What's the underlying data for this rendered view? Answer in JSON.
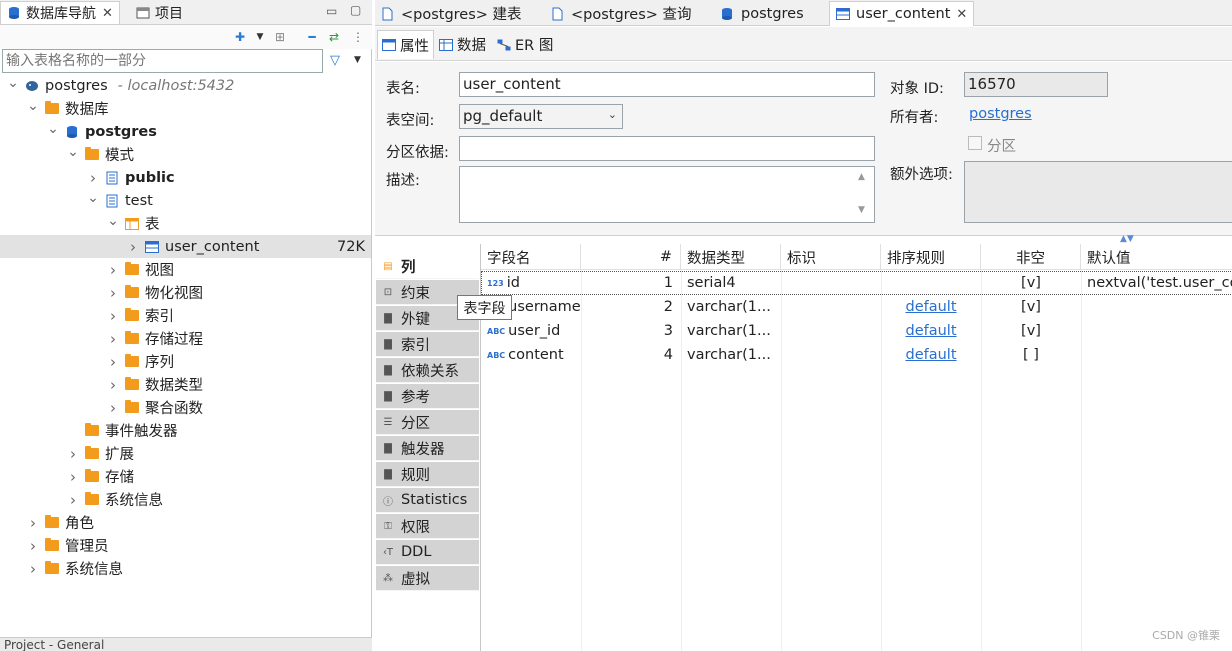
{
  "left_tabs": [
    {
      "label": "数据库导航",
      "icon": "database-navigator-icon",
      "closable": true
    },
    {
      "label": "项目",
      "icon": "project-icon",
      "closable": false
    }
  ],
  "filter": {
    "placeholder": "输入表格名称的一部分"
  },
  "tree": [
    {
      "label": "postgres",
      "suffix": "- localhost:5432",
      "indent": 0,
      "expanded": true,
      "icon": "postgres-elephant-icon",
      "bold": false
    },
    {
      "label": "数据库",
      "indent": 1,
      "expanded": true,
      "icon": "folder-icon"
    },
    {
      "label": "postgres",
      "indent": 2,
      "expanded": true,
      "icon": "database-icon",
      "bold": true
    },
    {
      "label": "模式",
      "indent": 3,
      "expanded": true,
      "icon": "folder-icon"
    },
    {
      "label": "public",
      "indent": 4,
      "expanded": false,
      "icon": "schema-icon",
      "bold": true
    },
    {
      "label": "test",
      "indent": 4,
      "expanded": true,
      "icon": "schema-icon"
    },
    {
      "label": "表",
      "indent": 5,
      "expanded": true,
      "icon": "tables-folder-icon"
    },
    {
      "label": "user_content",
      "indent": 6,
      "expanded": false,
      "icon": "table-icon",
      "selected": true,
      "size": "72K"
    },
    {
      "label": "视图",
      "indent": 5,
      "expanded": false,
      "icon": "folder-icon"
    },
    {
      "label": "物化视图",
      "indent": 5,
      "expanded": false,
      "icon": "folder-icon"
    },
    {
      "label": "索引",
      "indent": 5,
      "expanded": false,
      "icon": "folder-icon"
    },
    {
      "label": "存储过程",
      "indent": 5,
      "expanded": false,
      "icon": "folder-icon"
    },
    {
      "label": "序列",
      "indent": 5,
      "expanded": false,
      "icon": "folder-icon"
    },
    {
      "label": "数据类型",
      "indent": 5,
      "expanded": false,
      "icon": "folder-icon"
    },
    {
      "label": "聚合函数",
      "indent": 5,
      "expanded": false,
      "icon": "folder-icon"
    },
    {
      "label": "事件触发器",
      "indent": 3,
      "expanded": null,
      "icon": "folder-icon"
    },
    {
      "label": "扩展",
      "indent": 3,
      "expanded": false,
      "icon": "folder-icon"
    },
    {
      "label": "存储",
      "indent": 3,
      "expanded": false,
      "icon": "folder-icon"
    },
    {
      "label": "系统信息",
      "indent": 3,
      "expanded": false,
      "icon": "folder-icon"
    },
    {
      "label": "角色",
      "indent": 1,
      "expanded": false,
      "icon": "folder-icon"
    },
    {
      "label": "管理员",
      "indent": 1,
      "expanded": false,
      "icon": "folder-icon"
    },
    {
      "label": "系统信息",
      "indent": 1,
      "expanded": false,
      "icon": "folder-icon"
    }
  ],
  "bottom_panel": {
    "label": "Project - General"
  },
  "editor_tabs": [
    {
      "label": "<postgres> 建表",
      "icon": "sql-script-icon",
      "active": false
    },
    {
      "label": "<postgres> 查询",
      "icon": "sql-script-icon",
      "active": false
    },
    {
      "label": "postgres",
      "icon": "database-icon",
      "active": false
    },
    {
      "label": "user_content",
      "icon": "table-icon",
      "active": true
    }
  ],
  "sub_tabs": [
    {
      "label": "属性",
      "icon": "properties-icon",
      "active": true
    },
    {
      "label": "数据",
      "icon": "data-icon",
      "active": false
    },
    {
      "label": "ER 图",
      "icon": "er-diagram-icon",
      "active": false
    }
  ],
  "props": {
    "table_name_label": "表名:",
    "table_name": "user_content",
    "tablespace_label": "表空间:",
    "tablespace": "pg_default",
    "partition_label": "分区依据:",
    "partition": "",
    "desc_label": "描述:",
    "desc": "",
    "object_id_label": "对象 ID:",
    "object_id": "16570",
    "owner_label": "所有者:",
    "owner": "postgres",
    "partitioned_label": "分区",
    "partitioned": false,
    "extra_label": "额外选项:",
    "extra": ""
  },
  "vertical_tabs": [
    {
      "label": "列",
      "icon": "columns-icon",
      "active": true
    },
    {
      "label": "约束",
      "icon": "constraint-icon"
    },
    {
      "label": "外键",
      "icon": "foreign-key-icon"
    },
    {
      "label": "索引",
      "icon": "index-icon"
    },
    {
      "label": "依赖关系",
      "icon": "dependencies-icon"
    },
    {
      "label": "参考",
      "icon": "references-icon"
    },
    {
      "label": "分区",
      "icon": "partition-icon"
    },
    {
      "label": "触发器",
      "icon": "trigger-icon"
    },
    {
      "label": "规则",
      "icon": "rule-icon"
    },
    {
      "label": "Statistics",
      "icon": "info-icon"
    },
    {
      "label": "权限",
      "icon": "key-icon"
    },
    {
      "label": "DDL",
      "icon": "ddl-icon"
    },
    {
      "label": "虚拟",
      "icon": "virtual-icon"
    }
  ],
  "grid": {
    "headers": [
      "字段名",
      "#",
      "数据类型",
      "标识",
      "排序规则",
      "非空",
      "默认值"
    ],
    "rows": [
      {
        "name": "id",
        "type_icon": "numeric-column-icon",
        "ordinal": "1",
        "datatype": "serial4",
        "identity": "",
        "collation": "",
        "not_null": "[v]",
        "default": "nextval('test.user_content_id_seq'::regclass)"
      },
      {
        "name": "username",
        "type_icon": "text-column-icon",
        "ordinal": "2",
        "datatype": "varchar(1...",
        "identity": "",
        "collation": "default",
        "not_null": "[v]",
        "default": ""
      },
      {
        "name": "user_id",
        "type_icon": "text-column-icon",
        "ordinal": "3",
        "datatype": "varchar(1...",
        "identity": "",
        "collation": "default",
        "not_null": "[v]",
        "default": ""
      },
      {
        "name": "content",
        "type_icon": "text-column-icon",
        "ordinal": "4",
        "datatype": "varchar(1...",
        "identity": "",
        "collation": "default",
        "not_null": "[ ]",
        "default": ""
      }
    ]
  },
  "tooltip": "表字段",
  "watermark": "CSDN @锥栗"
}
